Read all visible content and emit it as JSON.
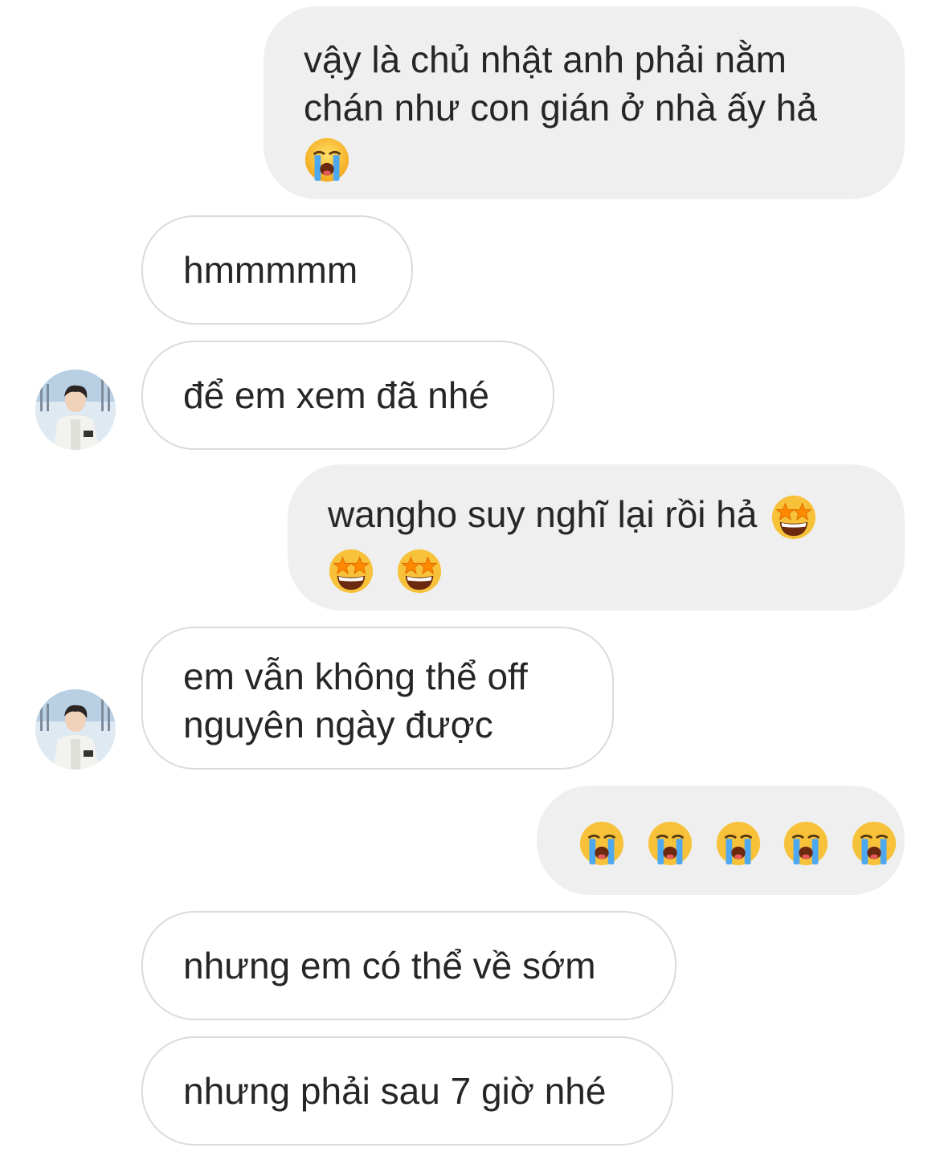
{
  "messages": [
    {
      "side": "sent",
      "text": "vậy là chủ nhật anh phải nằm chán như con gián ở nhà ấy hả",
      "emojis": [
        "loudly-crying-face-icon"
      ]
    },
    {
      "side": "received",
      "text": "hmmmmm"
    },
    {
      "side": "received",
      "text": "để em xem đã nhé"
    },
    {
      "side": "sent",
      "text": "wangho suy nghĩ lại rồi hả",
      "emojis": [
        "star-struck-face-icon",
        "star-struck-face-icon",
        "star-struck-face-icon"
      ]
    },
    {
      "side": "received",
      "text": "em vẫn không thể off nguyên ngày được"
    },
    {
      "side": "sent",
      "text": "",
      "emojis": [
        "loudly-crying-face-icon",
        "loudly-crying-face-icon",
        "loudly-crying-face-icon",
        "loudly-crying-face-icon",
        "loudly-crying-face-icon"
      ]
    },
    {
      "side": "received",
      "text": "nhưng em có thể về sớm"
    },
    {
      "side": "received",
      "text": "nhưng phải sau 7 giờ nhé"
    }
  ],
  "colors": {
    "sent_bubble": "#efefef",
    "received_border": "#dbdbdb",
    "text": "#262626"
  }
}
